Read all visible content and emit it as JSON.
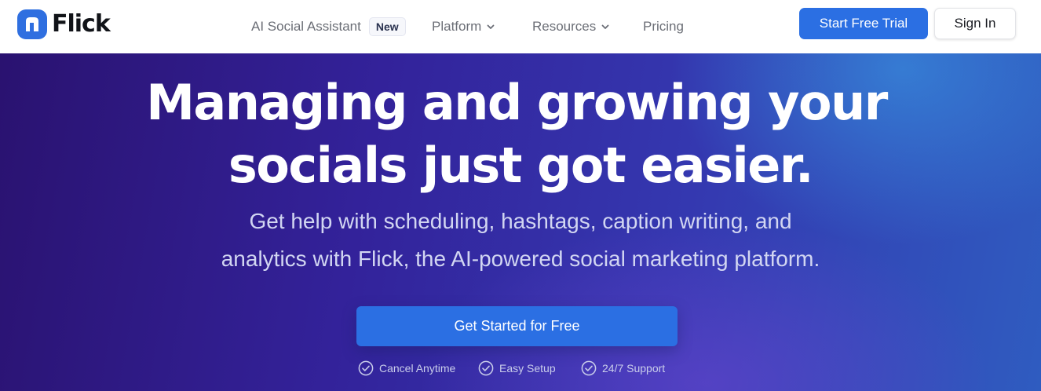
{
  "header": {
    "logo_text": "Flick",
    "logo_icon": "flick-logo-icon",
    "nav": {
      "ai_assistant": "AI Social Assistant",
      "new_badge": "New",
      "platform": "Platform",
      "resources": "Resources",
      "pricing": "Pricing"
    },
    "trial_button": "Start Free Trial",
    "signin_button": "Sign In"
  },
  "hero": {
    "headline_line1": "Managing and growing your",
    "headline_line2": "socials just got easier.",
    "subheadline_line1": "Get help with scheduling, hashtags, caption writing, and",
    "subheadline_line2": "analytics with Flick, the AI-powered social marketing platform.",
    "cta_button": "Get Started for Free",
    "features": [
      "Cancel Anytime",
      "Easy Setup",
      "24/7 Support"
    ],
    "feature_icon": "check-circle-icon"
  },
  "colors": {
    "brand_blue": "#2b6fe3",
    "hero_gradient_start": "#2a1270",
    "hero_gradient_end": "#2f5cc0",
    "text_dark": "#111318"
  }
}
